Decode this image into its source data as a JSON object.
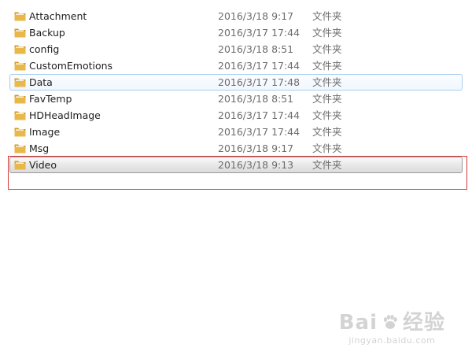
{
  "files": [
    {
      "name": "Attachment",
      "date": "2016/3/18 9:17",
      "type": "文件夹",
      "state": "normal"
    },
    {
      "name": "Backup",
      "date": "2016/3/17 17:44",
      "type": "文件夹",
      "state": "normal"
    },
    {
      "name": "config",
      "date": "2016/3/18 8:51",
      "type": "文件夹",
      "state": "normal"
    },
    {
      "name": "CustomEmotions",
      "date": "2016/3/17 17:44",
      "type": "文件夹",
      "state": "normal"
    },
    {
      "name": "Data",
      "date": "2016/3/17 17:48",
      "type": "文件夹",
      "state": "hover"
    },
    {
      "name": "FavTemp",
      "date": "2016/3/18 8:51",
      "type": "文件夹",
      "state": "normal"
    },
    {
      "name": "HDHeadImage",
      "date": "2016/3/17 17:44",
      "type": "文件夹",
      "state": "normal"
    },
    {
      "name": "Image",
      "date": "2016/3/17 17:44",
      "type": "文件夹",
      "state": "normal"
    },
    {
      "name": "Msg",
      "date": "2016/3/18 9:17",
      "type": "文件夹",
      "state": "normal"
    },
    {
      "name": "Video",
      "date": "2016/3/18 9:13",
      "type": "文件夹",
      "state": "selected"
    }
  ],
  "icons": {
    "folder": "folder-icon",
    "watermark_logo": "paw-icon"
  },
  "colors": {
    "folder_body": "#e8b84a",
    "folder_back": "#d49c2a",
    "hover_border": "#a9cdee",
    "selected_border": "#9a9a9a",
    "annotation_box": "#d43a3a"
  },
  "watermark": {
    "logo_left": "Bai",
    "logo_right": "经验",
    "url": "jingyan.baidu.com"
  }
}
